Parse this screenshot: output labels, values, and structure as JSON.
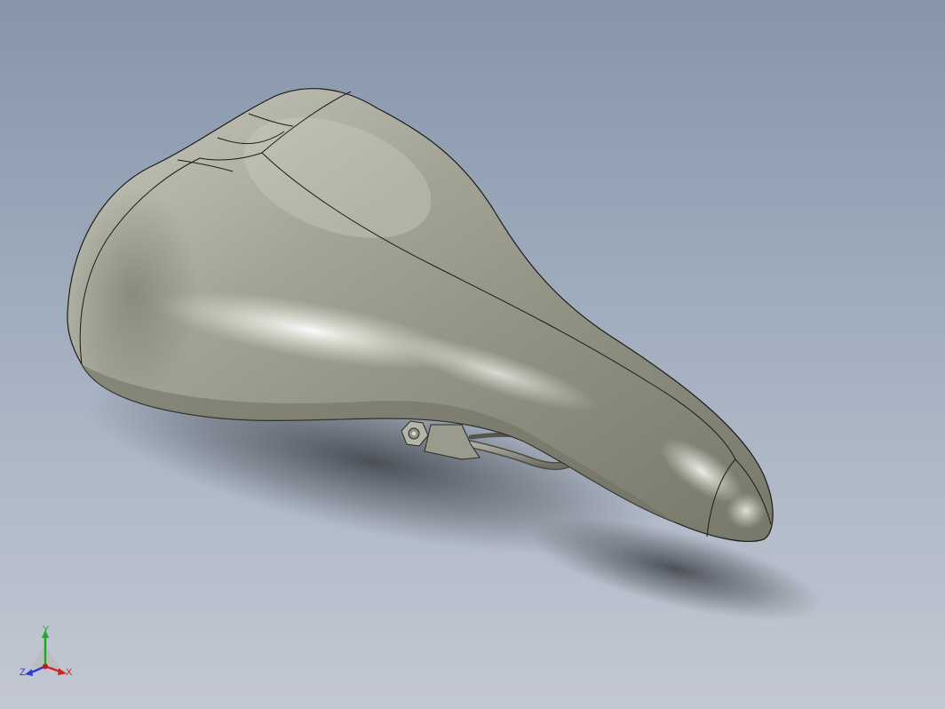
{
  "viewport": {
    "background_top": "#8795ab",
    "background_bottom": "#c3c8d3",
    "model_color": "#a5a597",
    "edge_color": "#1c1c18"
  },
  "model": {
    "type": "bicycle-saddle",
    "parts": [
      "saddle-shell",
      "seat-rail",
      "clamp-nut"
    ]
  },
  "triad": {
    "x_label": "X",
    "y_label": "Y",
    "z_label": "Z",
    "x_color": "#d62020",
    "y_color": "#1fa82a",
    "z_color": "#2a3fd6"
  }
}
